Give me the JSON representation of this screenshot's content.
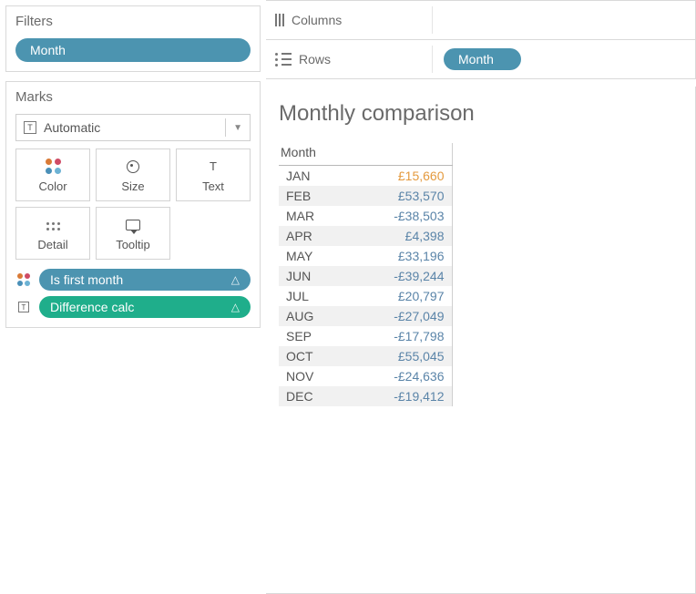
{
  "filters": {
    "title": "Filters",
    "pill_label": "Month"
  },
  "marks": {
    "title": "Marks",
    "dropdown_label": "Automatic",
    "buttons": {
      "color": "Color",
      "size": "Size",
      "text": "Text",
      "detail": "Detail",
      "tooltip": "Tooltip"
    },
    "pills": [
      {
        "label": "Is first month",
        "color": "blue",
        "icon": "color"
      },
      {
        "label": "Difference calc",
        "color": "green",
        "icon": "text"
      }
    ]
  },
  "shelves": {
    "columns_label": "Columns",
    "rows_label": "Rows",
    "rows_pill": "Month"
  },
  "viz": {
    "title": "Monthly comparison",
    "column_header": "Month",
    "rows": [
      {
        "month": "JAN",
        "value": "£15,660",
        "first": true
      },
      {
        "month": "FEB",
        "value": "£53,570",
        "first": false
      },
      {
        "month": "MAR",
        "value": "-£38,503",
        "first": false
      },
      {
        "month": "APR",
        "value": "£4,398",
        "first": false
      },
      {
        "month": "MAY",
        "value": "£33,196",
        "first": false
      },
      {
        "month": "JUN",
        "value": "-£39,244",
        "first": false
      },
      {
        "month": "JUL",
        "value": "£20,797",
        "first": false
      },
      {
        "month": "AUG",
        "value": "-£27,049",
        "first": false
      },
      {
        "month": "SEP",
        "value": "-£17,798",
        "first": false
      },
      {
        "month": "OCT",
        "value": "£55,045",
        "first": false
      },
      {
        "month": "NOV",
        "value": "-£24,636",
        "first": false
      },
      {
        "month": "DEC",
        "value": "-£19,412",
        "first": false
      }
    ]
  }
}
